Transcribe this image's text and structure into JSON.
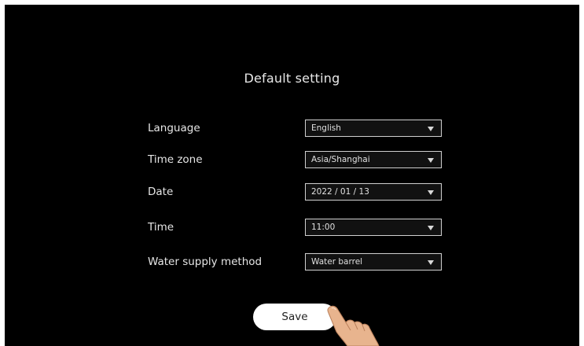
{
  "title": "Default setting",
  "settings": [
    {
      "label": "Language",
      "value": "English"
    },
    {
      "label": "Time zone",
      "value": "Asia/Shanghai"
    },
    {
      "label": "Date",
      "value": "2022 / 01 / 13"
    },
    {
      "label": "Time",
      "value": "11:00"
    },
    {
      "label": "Water supply method",
      "value": "Water barrel"
    }
  ],
  "save_label": "Save",
  "icons": {
    "dropdown": "caret-down-icon",
    "pointer": "pointing-hand-icon"
  },
  "colors": {
    "background": "#000000",
    "text": "#e6e6e6",
    "select_border": "#d0d0d0",
    "button_bg": "#ffffff"
  }
}
